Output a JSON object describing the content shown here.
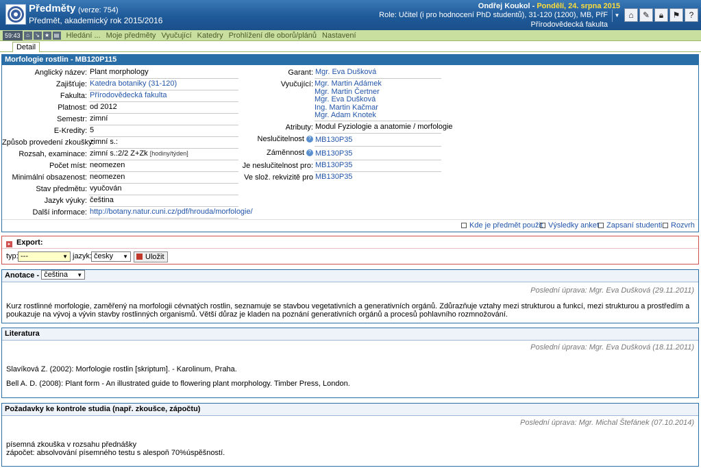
{
  "header": {
    "title": "Předměty",
    "version": "(verze: 754)",
    "subtitle": "Předmět, akademický rok 2015/2016",
    "user": "Ondřej Koukol",
    "date": "Pondělí, 24. srpna 2015",
    "role": "Role: Učitel (i pro hodnocení PhD studentů), 31-120 (1200), MB, PřF",
    "faculty": "Přírodovědecká fakulta",
    "icons": [
      "home-icon",
      "notes-icon",
      "lock-icon",
      "flag-icon",
      "help-icon"
    ]
  },
  "menubar": {
    "timer": "59:43",
    "items": [
      "Hledání ...",
      "Moje předměty",
      "Vyučující",
      "Katedry",
      "Prohlížení dle oborů/plánů",
      "Nastavení"
    ]
  },
  "tabs": {
    "detail": "Detail"
  },
  "detail": {
    "title": "Morfologie rostlin - MB120P115",
    "left": [
      {
        "label": "Anglický název:",
        "value": "Plant morphology"
      },
      {
        "label": "Zajišťuje:",
        "value": "Katedra botaniky (31-120)"
      },
      {
        "label": "Fakulta:",
        "value": "Přírodovědecká fakulta"
      },
      {
        "label": "Platnost:",
        "value": "od 2012"
      },
      {
        "label": "Semestr:",
        "value": "zimní"
      },
      {
        "label": "E-Kredity:",
        "value": "5"
      },
      {
        "label": "Způsob provedení zkoušky:",
        "value": "zimní s.:"
      },
      {
        "label": "Rozsah, examinace:",
        "value": "zimní s.:2/2 Z+Zk",
        "note": "[hodiny/týden]"
      },
      {
        "label": "Počet míst:",
        "value": "neomezen"
      },
      {
        "label": "Minimální obsazenost:",
        "value": "neomezen"
      },
      {
        "label": "Stav předmětu:",
        "value": "vyučován"
      },
      {
        "label": "Jazyk výuky:",
        "value": "čeština"
      },
      {
        "label": "Další informace:",
        "value": "http://botany.natur.cuni.cz/pdf/hrouda/morfologie/"
      }
    ],
    "garant_label": "Garant:",
    "garant": "Mgr. Eva Dušková",
    "teachers_label": "Vyučující:",
    "teachers": [
      "Mgr. Martin Adámek",
      "Mgr. Martin Čertner",
      "Mgr. Eva Dušková",
      "Ing. Martin Kačmar",
      "Mgr. Adam Knotek"
    ],
    "attributes_label": "Atributy:",
    "attributes": "Modul Fyziologie a anatomie / morfologie",
    "incompat_label": "Neslučitelnost",
    "incompat": "MB130P35",
    "interchange_label": "Záměnnost",
    "interchange": "MB130P35",
    "incompat_for_label": "Je neslučitelnost pro:",
    "incompat_for": "MB130P35",
    "prereq_for_label": "Ve slož. rekvizitě pro",
    "prereq_for": "MB130P35",
    "links": [
      "Kde je předmět použit",
      "Výsledky anket",
      "Zapsaní studenti",
      "Rozvrh"
    ]
  },
  "export": {
    "title": "Export:",
    "type_label": "typ:",
    "type_value": "---",
    "lang_label": "jazyk:",
    "lang_value": "česky",
    "save_label": "Uložit"
  },
  "annotation": {
    "title": "Anotace -",
    "lang": "čeština",
    "edited": "Poslední úprava: Mgr. Eva Dušková (29.11.2011)",
    "text": "Kurz rostlinné morfologie, zaměřený na morfologii cévnatých rostlin, seznamuje se stavbou vegetativních a generativních orgánů. Zdůrazňuje vztahy mezi strukturou a funkcí, mezi strukturou a prostředím a poukazuje na vývoj a vývin stavby rostlinných organismů. Větší důraz je kladen na poznání generativních orgánů a procesů pohlavního rozmnožování."
  },
  "literature": {
    "title": "Literatura",
    "edited": "Poslední úprava: Mgr. Eva Dušková (18.11.2011)",
    "items": [
      "Slavíková Z. (2002): Morfologie rostlin [skriptum]. - Karolinum, Praha.",
      "Bell A. D. (2008): Plant form - An illustrated guide to flowering plant morphology. Timber Press, London."
    ]
  },
  "requirements": {
    "title": "Požadavky ke kontrole studia (např. zkoušce, zápočtu)",
    "edited": "Poslední úprava: Mgr. Michal Štefánek (07.10.2014)",
    "lines": [
      "písemná zkouška v rozsahu přednášky",
      "zápočet: absolvování písemného testu s alespoň 70%úspěšností."
    ]
  }
}
